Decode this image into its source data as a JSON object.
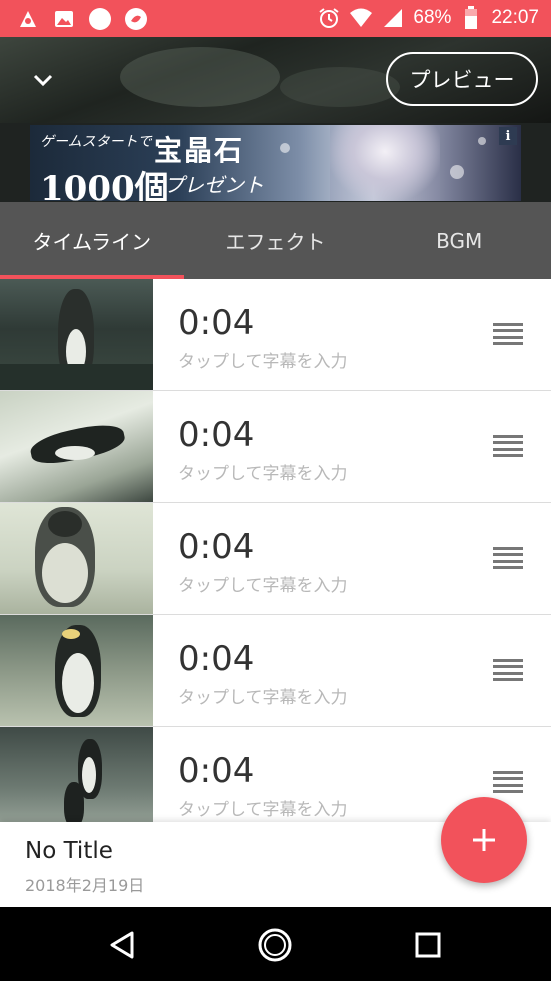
{
  "status_bar": {
    "battery": "68%",
    "time": "22:07",
    "icons": [
      "app-notification-icon",
      "image-icon",
      "circle-icon",
      "chat-app-icon",
      "alarm-icon",
      "wifi-icon",
      "signal-icon",
      "battery-icon"
    ]
  },
  "header": {
    "preview_label": "プレビュー"
  },
  "ad_banner": {
    "line1": "ゲームスタートで",
    "big1": "宝晶石",
    "big2": "1000個",
    "line2": "プレゼント",
    "info": "i"
  },
  "tabs": [
    {
      "label": "タイムライン",
      "active": true
    },
    {
      "label": "エフェクト",
      "active": false
    },
    {
      "label": "BGM",
      "active": false
    }
  ],
  "clips": [
    {
      "duration": "0:04",
      "caption_placeholder": "タップして字幕を入力"
    },
    {
      "duration": "0:04",
      "caption_placeholder": "タップして字幕を入力"
    },
    {
      "duration": "0:04",
      "caption_placeholder": "タップして字幕を入力"
    },
    {
      "duration": "0:04",
      "caption_placeholder": "タップして字幕を入力"
    },
    {
      "duration": "0:04",
      "caption_placeholder": "タップして字幕を入力"
    }
  ],
  "footer": {
    "title": "No Title",
    "date": "2018年2月19日"
  },
  "colors": {
    "accent": "#f2525b",
    "tab_bar": "#555555"
  }
}
